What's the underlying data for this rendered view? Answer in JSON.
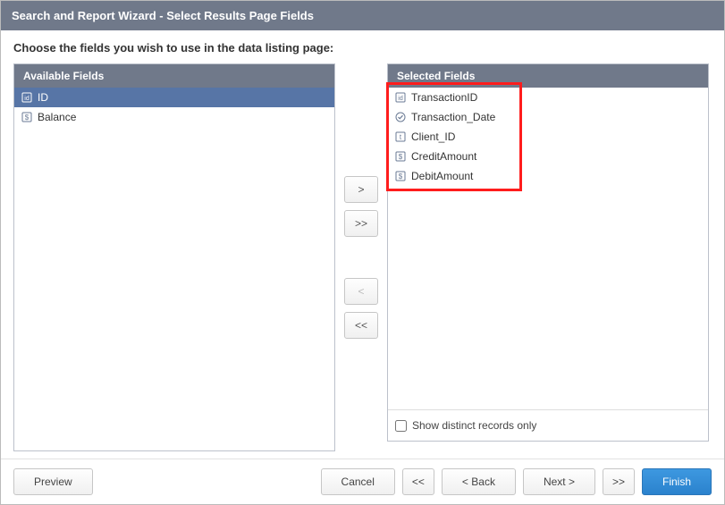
{
  "titleBar": "Search and Report Wizard - Select Results Page Fields",
  "instruction": "Choose the fields you wish to use in the data listing page:",
  "panels": {
    "availableHeader": "Available Fields",
    "selectedHeader": "Selected Fields"
  },
  "availableFields": [
    {
      "label": "ID",
      "iconType": "id",
      "selected": true
    },
    {
      "label": "Balance",
      "iconType": "currency",
      "selected": false
    }
  ],
  "selectedFields": [
    {
      "label": "TransactionID",
      "iconType": "id"
    },
    {
      "label": "Transaction_Date",
      "iconType": "date"
    },
    {
      "label": "Client_ID",
      "iconType": "text"
    },
    {
      "label": "CreditAmount",
      "iconType": "currency"
    },
    {
      "label": "DebitAmount",
      "iconType": "currency"
    }
  ],
  "transferButtons": {
    "addOne": ">",
    "addAll": ">>",
    "removeOne": "<",
    "removeAll": "<<"
  },
  "distinctCheckbox": {
    "checked": false,
    "label": "Show distinct records only"
  },
  "footerButtons": {
    "preview": "Preview",
    "cancel": "Cancel",
    "first": "<<",
    "back": "< Back",
    "next": "Next >",
    "last": ">>",
    "finish": "Finish"
  },
  "iconColors": {
    "availableNormal": "#6a7a94",
    "availableSelected": "#ffffff",
    "selectedNormal": "#6a7a94"
  }
}
